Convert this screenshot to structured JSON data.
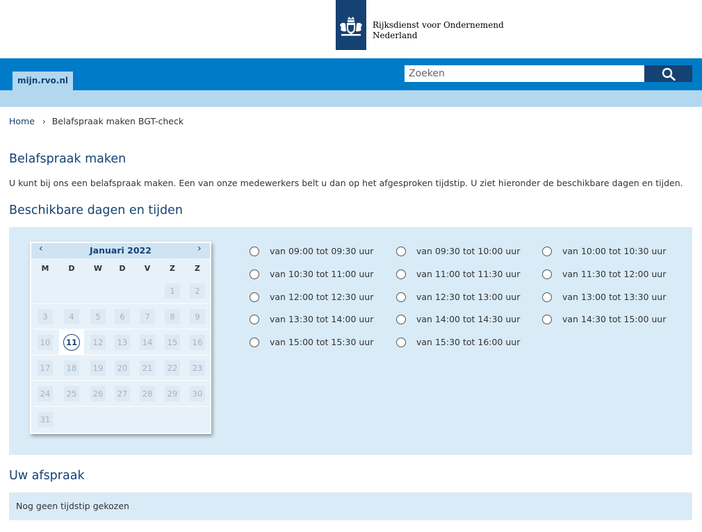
{
  "header": {
    "org_line1": "Rijksdienst voor Ondernemend",
    "org_line2": "Nederland",
    "site_tab": "mijn.rvo.nl",
    "search_placeholder": "Zoeken"
  },
  "breadcrumb": {
    "home": "Home",
    "current": "Belafspraak maken BGT-check"
  },
  "page": {
    "title": "Belafspraak maken",
    "intro": "U kunt bij ons een belafspraak maken. Een van onze medewerkers belt u dan op het afgesproken tijdstip. U ziet hieronder de beschikbare dagen en tijden.",
    "section_title": "Beschikbare dagen en tijden"
  },
  "calendar": {
    "month_label": "Januari 2022",
    "prev_icon": "chevron-left-icon",
    "next_icon": "chevron-right-icon",
    "weekdays": [
      "M",
      "D",
      "W",
      "D",
      "V",
      "Z",
      "Z"
    ],
    "first_weekday_index": 5,
    "days_in_month": 31,
    "available_days": [
      11
    ]
  },
  "time_slots": [
    "van 09:00 tot 09:30 uur",
    "van 09:30 tot 10:00 uur",
    "van 10:00 tot 10:30 uur",
    "van 10:30 tot 11:00 uur",
    "van 11:00 tot 11:30 uur",
    "van 11:30 tot 12:00 uur",
    "van 12:00 tot 12:30 uur",
    "van 12:30 tot 13:00 uur",
    "van 13:00 tot 13:30 uur",
    "van 13:30 tot 14:00 uur",
    "van 14:00 tot 14:30 uur",
    "van 14:30 tot 15:00 uur",
    "van 15:00 tot 15:30 uur",
    "van 15:30 tot 16:00 uur"
  ],
  "appointment": {
    "title": "Uw afspraak",
    "status": "Nog geen tijdstip gekozen"
  },
  "colors": {
    "brand_dark": "#154273",
    "brand_blue": "#007bc7",
    "light_blue": "#b2d7ee",
    "panel_bg": "#d9ebf7"
  }
}
